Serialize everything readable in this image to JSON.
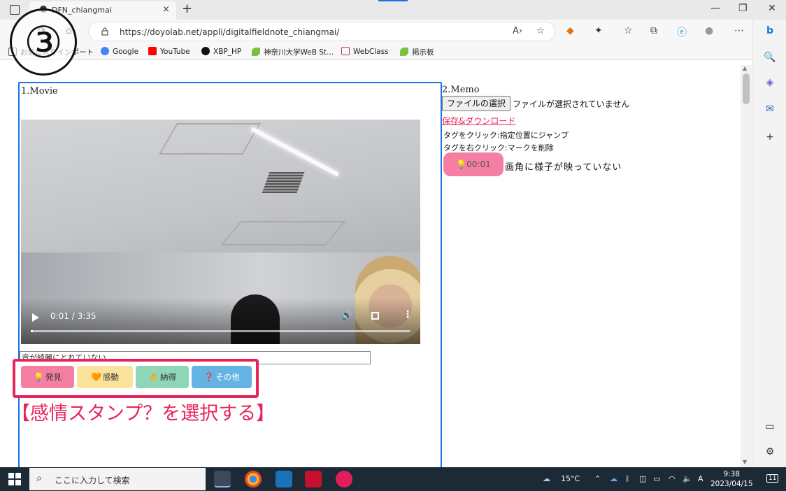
{
  "browser": {
    "tab_title": "DFN_chiangmai",
    "tab_close": "×",
    "new_tab": "+",
    "url": "https://doyolab.net/appli/digitalfieldnote_chiangmai/",
    "window_controls": [
      "—",
      "❐",
      "✕"
    ]
  },
  "bookmarks": [
    {
      "label": "お気に入りインポート",
      "icon": "import-icon",
      "color": "#555555"
    },
    {
      "label": "Google",
      "icon": "google-icon",
      "color": "#4285f4"
    },
    {
      "label": "YouTube",
      "icon": "youtube-icon",
      "color": "#ff0000"
    },
    {
      "label": "XBP_HP",
      "icon": "github-icon",
      "color": "#111111"
    },
    {
      "label": "神奈川大学WeB St...",
      "icon": "leaf-icon",
      "color": "#7ac142"
    },
    {
      "label": "WebClass",
      "icon": "webclass-icon",
      "color": "#c04060"
    },
    {
      "label": "掲示板",
      "icon": "leaf-icon",
      "color": "#7ac142"
    }
  ],
  "annotation_number": "③",
  "movie": {
    "title": "1.Movie",
    "time": "0:01 / 3:35",
    "progress": 0.005,
    "memo_input_value": "音が綺麗にとれていない",
    "stamps": [
      {
        "label": "発見",
        "icon": "lightbulb-icon",
        "glyph": "💡",
        "bg": "#f47fa3"
      },
      {
        "label": "感動",
        "icon": "heart-icon",
        "glyph": "🧡",
        "bg": "#fbe29a"
      },
      {
        "label": "納得",
        "icon": "okay-hand-icon",
        "glyph": "👌",
        "bg": "#8fd6b9"
      },
      {
        "label": "その他",
        "icon": "question-icon",
        "glyph": "❓",
        "bg": "#64b3e3"
      }
    ],
    "instruction": "【感情スタンプ？を選択する】"
  },
  "memo": {
    "title": "2.Memo",
    "file_button": "ファイルの選択",
    "file_status": "ファイルが選択されていません",
    "save_link": "保存&ダウンロード",
    "help_click": "タグをクリック:指定位置にジャンプ",
    "help_right_click": "タグを右クリック:マークを削除",
    "tag_time": "00:01",
    "tag_icon": "lightbulb-icon",
    "tag_note": "画角に様子が映っていない"
  },
  "taskbar": {
    "search_placeholder": "ここに入力して検索",
    "temperature": "15°C",
    "ime": "A",
    "time": "9:38",
    "date": "2023/04/15",
    "notifications": "11"
  }
}
